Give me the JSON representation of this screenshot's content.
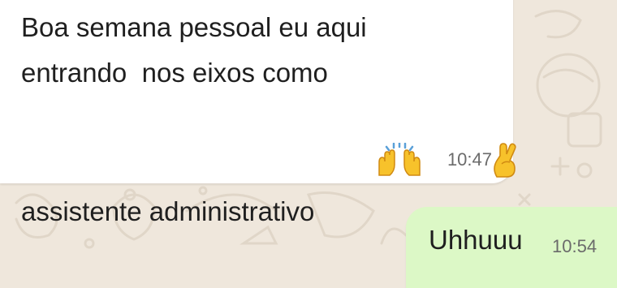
{
  "chat": {
    "incoming": {
      "lines": [
        "Boa semana pessoal eu aqui",
        "entrando  nos eixos como",
        "assistente administrativo"
      ],
      "emojis": [
        "raising-hands-emoji",
        "crossed-fingers-emoji"
      ],
      "time": "10:47"
    },
    "outgoing": {
      "text": "Uhhuuu",
      "time": "10:54"
    }
  },
  "colors": {
    "wallpaper": "#efe7dc",
    "incoming_bubble": "#ffffff",
    "outgoing_bubble": "#dcf8c6",
    "text": "#1f1f1f",
    "timestamp": "#6b6b6b"
  }
}
